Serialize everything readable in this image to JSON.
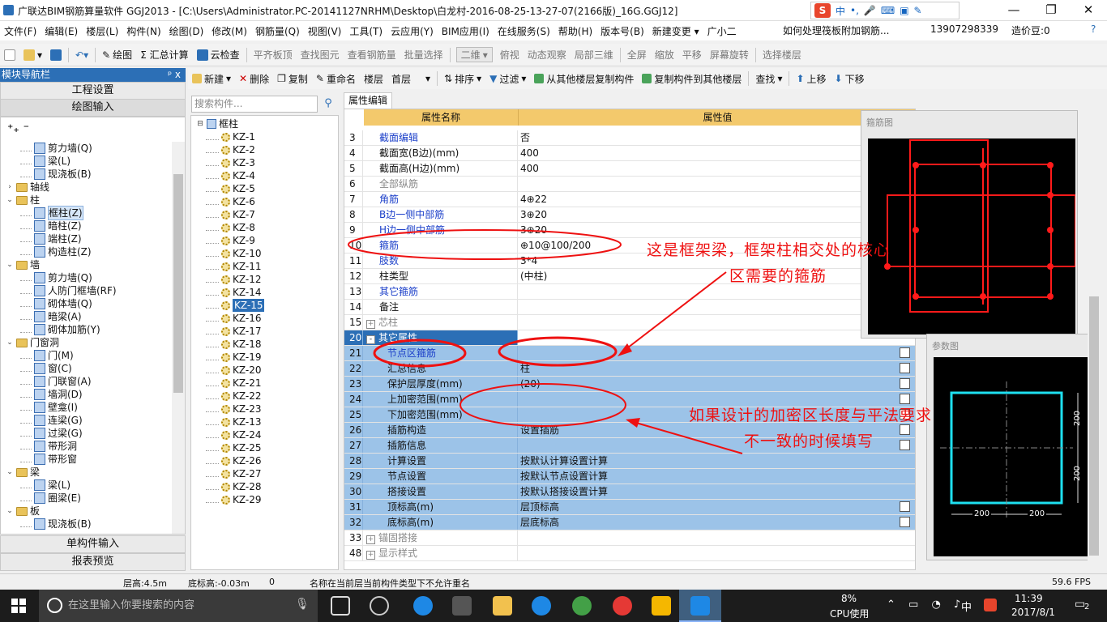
{
  "window": {
    "title": "广联达BIM钢筋算量软件 GGJ2013 - [C:\\Users\\Administrator.PC-20141127NRHM\\Desktop\\白龙村-2016-08-25-13-27-07(2166版)_16G.GGJ12]"
  },
  "ime": {
    "mode": "中"
  },
  "menu": {
    "items": [
      "文件(F)",
      "编辑(E)",
      "楼层(L)",
      "构件(N)",
      "绘图(D)",
      "修改(M)",
      "钢筋量(Q)",
      "视图(V)",
      "工具(T)",
      "云应用(Y)",
      "BIM应用(I)",
      "在线服务(S)",
      "帮助(H)",
      "版本号(B)",
      "新建变更 ▾",
      "广小二"
    ],
    "help_link": "如何处理筏板附加钢筋...",
    "phone": "13907298339",
    "beans": "造价豆:0"
  },
  "toolbar1": {
    "items": [
      "绘图",
      "Σ 汇总计算",
      "云检查",
      "平齐板顶",
      "查找图元",
      "查看钢筋量",
      "批量选择",
      "二维",
      "俯视",
      "动态观察",
      "局部三维",
      "全屏",
      "缩放",
      "平移",
      "屏幕旋转",
      "选择楼层"
    ]
  },
  "nav": {
    "header": "模块导航栏",
    "pin": "ᵖ x",
    "btn_project": "工程设置",
    "btn_draw": "绘图输入",
    "btn_single": "单构件输入",
    "btn_report": "报表预览",
    "tree": [
      {
        "label": "剪力墙(Q)",
        "level": 2
      },
      {
        "label": "梁(L)",
        "level": 2
      },
      {
        "label": "现浇板(B)",
        "level": 2
      },
      {
        "label": "轴线",
        "level": 1,
        "folder": true,
        "toggle": ">"
      },
      {
        "label": "柱",
        "level": 1,
        "folder": true,
        "toggle": "v"
      },
      {
        "label": "框柱(Z)",
        "level": 2,
        "selected": true
      },
      {
        "label": "暗柱(Z)",
        "level": 2
      },
      {
        "label": "端柱(Z)",
        "level": 2
      },
      {
        "label": "构造柱(Z)",
        "level": 2
      },
      {
        "label": "墙",
        "level": 1,
        "folder": true,
        "toggle": "v"
      },
      {
        "label": "剪力墙(Q)",
        "level": 2
      },
      {
        "label": "人防门框墙(RF)",
        "level": 2
      },
      {
        "label": "砌体墙(Q)",
        "level": 2
      },
      {
        "label": "暗梁(A)",
        "level": 2
      },
      {
        "label": "砌体加筋(Y)",
        "level": 2
      },
      {
        "label": "门窗洞",
        "level": 1,
        "folder": true,
        "toggle": "v"
      },
      {
        "label": "门(M)",
        "level": 2
      },
      {
        "label": "窗(C)",
        "level": 2
      },
      {
        "label": "门联窗(A)",
        "level": 2
      },
      {
        "label": "墙洞(D)",
        "level": 2
      },
      {
        "label": "壁龛(I)",
        "level": 2
      },
      {
        "label": "连梁(G)",
        "level": 2
      },
      {
        "label": "过梁(G)",
        "level": 2
      },
      {
        "label": "带形洞",
        "level": 2
      },
      {
        "label": "带形窗",
        "level": 2
      },
      {
        "label": "梁",
        "level": 1,
        "folder": true,
        "toggle": "v"
      },
      {
        "label": "梁(L)",
        "level": 2
      },
      {
        "label": "圈梁(E)",
        "level": 2
      },
      {
        "label": "板",
        "level": 1,
        "folder": true,
        "toggle": "v"
      },
      {
        "label": "现浇板(B)",
        "level": 2
      }
    ]
  },
  "midtoolbar": {
    "new": "新建",
    "delete": "删除",
    "copy": "复制",
    "rename": "重命名",
    "floor_label": "楼层",
    "floor_value": "首层",
    "sort": "排序",
    "filter": "过滤",
    "copy_from": "从其他楼层复制构件",
    "copy_to": "复制构件到其他楼层",
    "find": "查找",
    "up": "上移",
    "down": "下移"
  },
  "search": {
    "placeholder": "搜索构件..."
  },
  "components": {
    "root": "框柱",
    "items": [
      "KZ-1",
      "KZ-2",
      "KZ-3",
      "KZ-4",
      "KZ-5",
      "KZ-6",
      "KZ-7",
      "KZ-8",
      "KZ-9",
      "KZ-10",
      "KZ-11",
      "KZ-12",
      "KZ-14",
      "KZ-15",
      "KZ-16",
      "KZ-17",
      "KZ-18",
      "KZ-19",
      "KZ-20",
      "KZ-21",
      "KZ-22",
      "KZ-23",
      "KZ-13",
      "KZ-24",
      "KZ-25",
      "KZ-26",
      "KZ-27",
      "KZ-28",
      "KZ-29"
    ],
    "selected": "KZ-15"
  },
  "props": {
    "tab": "属性编辑",
    "col_name": "属性名称",
    "col_value": "属性值",
    "rows": [
      {
        "n": "3",
        "k": "截面编辑",
        "v": "否",
        "style": "blue"
      },
      {
        "n": "4",
        "k": "截面宽(B边)(mm)",
        "v": "400"
      },
      {
        "n": "5",
        "k": "截面高(H边)(mm)",
        "v": "400"
      },
      {
        "n": "6",
        "k": "全部纵筋",
        "v": "",
        "style": "gray"
      },
      {
        "n": "7",
        "k": "角筋",
        "v": "4⊕22",
        "style": "blue"
      },
      {
        "n": "8",
        "k": "B边一侧中部筋",
        "v": "3⊕20",
        "style": "blue"
      },
      {
        "n": "9",
        "k": "H边一侧中部筋",
        "v": "3⊕20",
        "style": "blue"
      },
      {
        "n": "10",
        "k": "箍筋",
        "v": "⊕10@100/200",
        "style": "blue"
      },
      {
        "n": "11",
        "k": "肢数",
        "v": "3*4",
        "style": "blue"
      },
      {
        "n": "12",
        "k": "柱类型",
        "v": "(中柱)"
      },
      {
        "n": "13",
        "k": "其它箍筋",
        "v": "",
        "style": "blue"
      },
      {
        "n": "14",
        "k": "备注",
        "v": ""
      },
      {
        "n": "15",
        "k": "芯柱",
        "v": "",
        "style": "gray",
        "expand": "+"
      },
      {
        "n": "20",
        "k": "其它属性",
        "v": "",
        "style": "selhead",
        "expand": "-"
      },
      {
        "n": "21",
        "k": "节点区箍筋",
        "v": "",
        "style": "sel blue",
        "cb": true
      },
      {
        "n": "22",
        "k": "汇总信息",
        "v": "柱",
        "style": "sel",
        "cb": true
      },
      {
        "n": "23",
        "k": "保护层厚度(mm)",
        "v": "(20)",
        "style": "sel",
        "cb": true
      },
      {
        "n": "24",
        "k": "上加密范围(mm)",
        "v": "",
        "style": "sel",
        "cb": true
      },
      {
        "n": "25",
        "k": "下加密范围(mm)",
        "v": "",
        "style": "sel",
        "cb": true
      },
      {
        "n": "26",
        "k": "插筋构造",
        "v": "设置插筋",
        "style": "sel",
        "cb": true
      },
      {
        "n": "27",
        "k": "插筋信息",
        "v": "",
        "style": "sel",
        "cb": true
      },
      {
        "n": "28",
        "k": "计算设置",
        "v": "按默认计算设置计算",
        "style": "sel"
      },
      {
        "n": "29",
        "k": "节点设置",
        "v": "按默认节点设置计算",
        "style": "sel"
      },
      {
        "n": "30",
        "k": "搭接设置",
        "v": "按默认搭接设置计算",
        "style": "sel"
      },
      {
        "n": "31",
        "k": "顶标高(m)",
        "v": "层顶标高",
        "style": "sel",
        "cb": true
      },
      {
        "n": "32",
        "k": "底标高(m)",
        "v": "层底标高",
        "style": "sel",
        "cb": true
      },
      {
        "n": "33",
        "k": "锚固搭接",
        "v": "",
        "style": "gray",
        "expand": "+"
      },
      {
        "n": "48",
        "k": "显示样式",
        "v": "",
        "style": "gray",
        "expand": "+"
      }
    ]
  },
  "diagrams": {
    "rebar_title": "箍筋图",
    "param_title": "参数图",
    "dim_200a": "200",
    "dim_200b": "200",
    "dim_200c": "200",
    "dim_200d": "200"
  },
  "annotations": {
    "a1_line1": "这是框架梁，框架柱相交处的核心",
    "a1_line2": "区需要的箍筋",
    "a2_line1": "如果设计的加密区长度与平法要求",
    "a2_line2": "不一致的时候填写"
  },
  "status": {
    "floor_height": "层高:4.5m",
    "base_elev": "底标高:-0.03m",
    "zero": "0",
    "message": "名称在当前层当前构件类型下不允许重名",
    "fps": "59.6 FPS"
  },
  "taskbar": {
    "search_placeholder": "在这里输入你要搜索的内容",
    "cpu": "8%",
    "cpu_label": "CPU使用",
    "ime": "中",
    "time": "11:39",
    "date": "2017/8/1",
    "notif": "2"
  },
  "colors": {
    "accent": "#2c6fb6",
    "selection": "#9cc3e8",
    "header": "#f3c96c",
    "annotation": "#e11111",
    "rebar": "#ff1a1a",
    "param": "#1ee0f0"
  }
}
